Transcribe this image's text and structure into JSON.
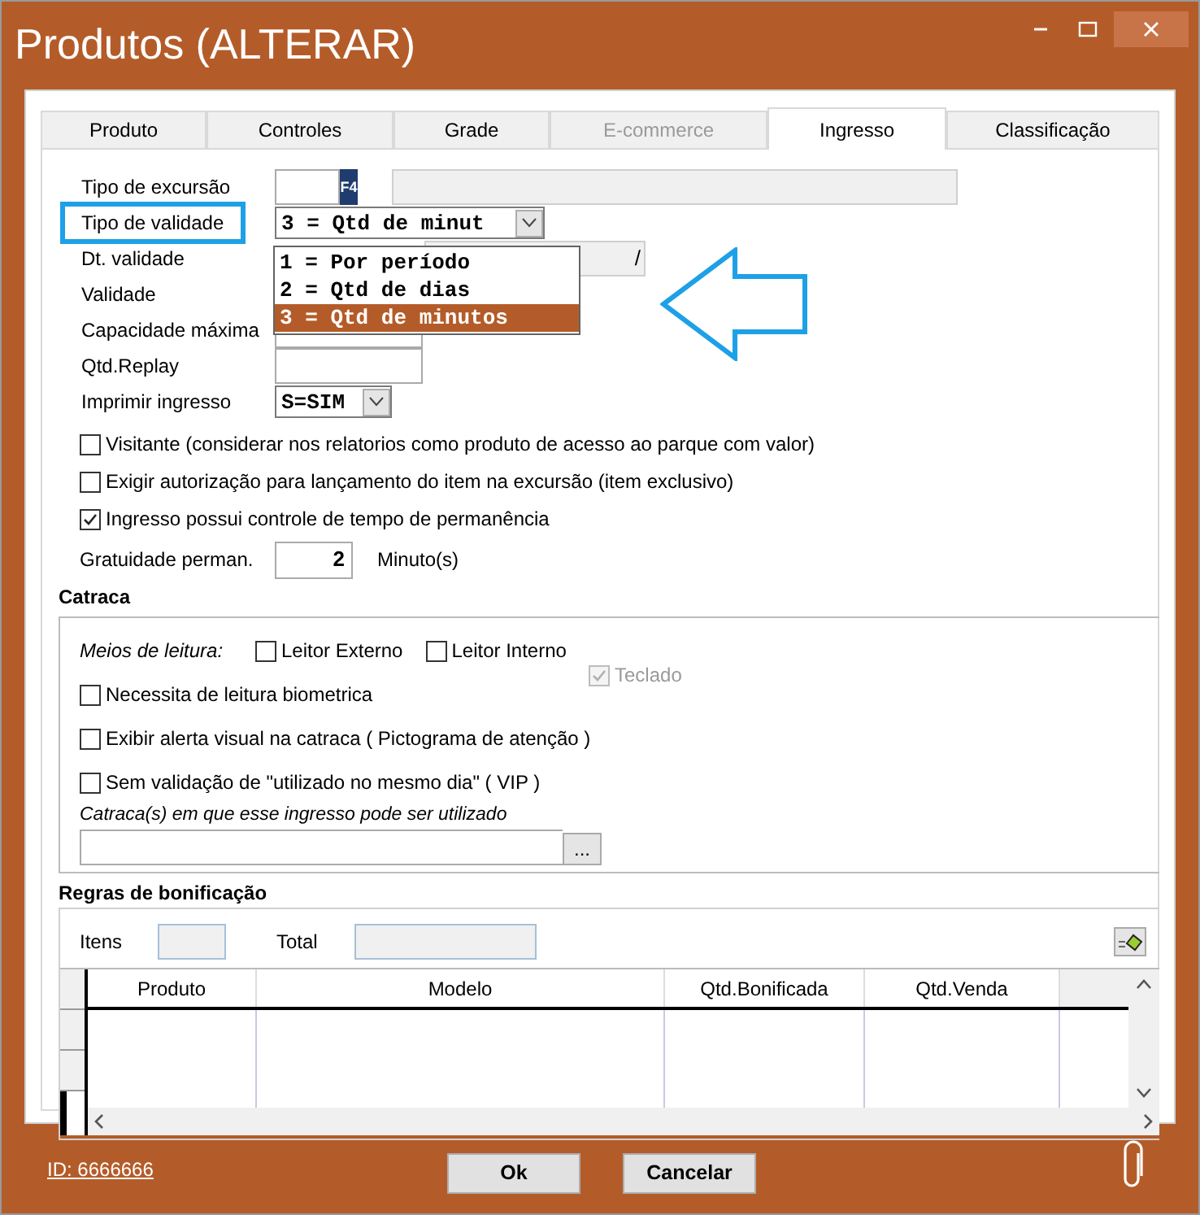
{
  "window": {
    "title": "Produtos (ALTERAR)"
  },
  "tabs": [
    {
      "label": "Produto",
      "selected": false,
      "disabled": false
    },
    {
      "label": "Controles",
      "selected": false,
      "disabled": false
    },
    {
      "label": "Grade",
      "selected": false,
      "disabled": false
    },
    {
      "label": "E-commerce",
      "selected": false,
      "disabled": true
    },
    {
      "label": "Ingresso",
      "selected": true,
      "disabled": false
    },
    {
      "label": "Classificação",
      "selected": false,
      "disabled": false
    }
  ],
  "form": [
    {
      "label": "Tipo de excursão",
      "kind": "lookup",
      "key": "F4",
      "annotated": false
    },
    {
      "label": "Tipo de validade",
      "kind": "combo",
      "value": "3 = Qtd de minut",
      "annotated": true
    },
    {
      "label": "Dt. validade",
      "kind": "date",
      "value": "/",
      "annotated": false
    },
    {
      "label": "Validade",
      "kind": "covered",
      "annotated": false
    },
    {
      "label": "Capacidade máxima",
      "kind": "text",
      "annotated": false
    },
    {
      "label": "Qtd.Replay",
      "kind": "text",
      "annotated": false
    },
    {
      "label": "Imprimir ingresso",
      "kind": "combo_small",
      "value": "S=SIM",
      "annotated": false
    }
  ],
  "dropdown": [
    {
      "label": "1 = Por período",
      "selected": false
    },
    {
      "label": "2 = Qtd de dias",
      "selected": false
    },
    {
      "label": "3 = Qtd de minutos",
      "selected": true
    }
  ],
  "options": [
    {
      "label": "Visitante (considerar nos relatorios como produto de acesso ao parque com valor)",
      "checked": false
    },
    {
      "label": "Exigir autorização para lançamento do item  na excursão (item exclusivo)",
      "checked": false
    },
    {
      "label": "Ingresso possui controle de tempo de permanência",
      "checked": true
    }
  ],
  "gratuity": {
    "label": "Gratuidade perman.",
    "value": "2",
    "unit": "Minuto(s)"
  },
  "catraca": {
    "title": "Catraca",
    "reading_label": "Meios de leitura:",
    "readers": [
      {
        "label": "Leitor Externo",
        "checked": false
      },
      {
        "label": "Leitor Interno",
        "checked": false
      }
    ],
    "keyboard": {
      "label": "Teclado",
      "checked": true,
      "disabled": true
    },
    "options": [
      {
        "label": "Necessita de leitura biometrica",
        "checked": false
      },
      {
        "label": "Exibir alerta visual na catraca ( Pictograma de atenção )",
        "checked": false
      },
      {
        "label": "Sem validação de \"utilizado no mesmo dia\" ( VIP )",
        "checked": false
      }
    ],
    "turnstiles_label": "Catraca(s) em que esse ingresso pode ser utilizado",
    "browse": "..."
  },
  "bonus": {
    "title": "Regras de bonificação",
    "items_label": "Itens",
    "total_label": "Total",
    "columns": [
      "Produto",
      "Modelo",
      "Qtd.Bonificada",
      "Qtd.Venda"
    ]
  },
  "footer": {
    "id_link": "ID: 6666666",
    "buttons": [
      "Ok",
      "Cancelar"
    ]
  }
}
